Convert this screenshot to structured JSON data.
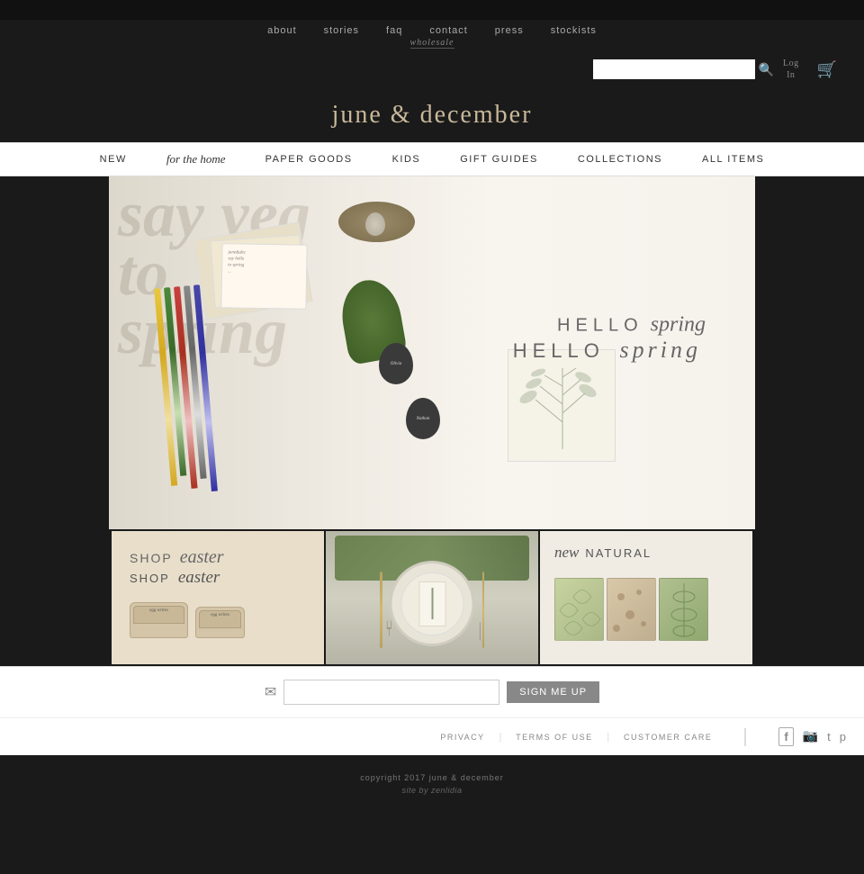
{
  "topbar": {
    "text": ""
  },
  "nav": {
    "items": [
      {
        "label": "about",
        "href": "#"
      },
      {
        "label": "stories",
        "href": "#"
      },
      {
        "label": "FAQ",
        "href": "#"
      },
      {
        "label": "contact",
        "href": "#"
      },
      {
        "label": "press",
        "href": "#"
      },
      {
        "label": "stockists",
        "href": "#"
      }
    ],
    "wholesale": "wholesale"
  },
  "header": {
    "search_placeholder": "",
    "search_icon": "🔍",
    "cart_icon": "🛒",
    "login_line1": "Log",
    "login_line2": "In",
    "logo": "june & december"
  },
  "main_nav": {
    "items": [
      {
        "label": "NEW",
        "style": "caps"
      },
      {
        "label": "for the HOME",
        "style": "script"
      },
      {
        "label": "PAPER GOODS",
        "style": "caps"
      },
      {
        "label": "KIDS",
        "style": "caps"
      },
      {
        "label": "GIFT GUIDES",
        "style": "caps"
      },
      {
        "label": "COLLECTIONS",
        "style": "caps"
      },
      {
        "label": "ALL ITEMS",
        "style": "caps"
      }
    ]
  },
  "hero": {
    "hello_text": "HELLO",
    "spring_text": "spring",
    "calligraphy_text": "say yeg to spring"
  },
  "panels": [
    {
      "id": "easter",
      "shop_label": "SHOP",
      "easter_label": "easter",
      "egg_label1": "egg writes",
      "egg_label2": "egg writes"
    },
    {
      "id": "natural-setting",
      "alt": "natural place setting with herbs and plates"
    },
    {
      "id": "new-natural",
      "new_label": "new",
      "natural_label": "NATURAL",
      "swatches": [
        {
          "color": "#c8d4a0",
          "pattern": "botanical"
        },
        {
          "color": "#d4e0a8",
          "pattern": "floral"
        },
        {
          "color": "#b8c890",
          "pattern": "leaf"
        },
        {
          "color": "#e0d4b0",
          "pattern": "neutral"
        }
      ]
    }
  ],
  "footer": {
    "email_placeholder": "",
    "sign_up_btn": "SIGN ME UP",
    "links": [
      {
        "label": "PRIVACY"
      },
      {
        "label": "TERMS OF USE"
      },
      {
        "label": "CUSTOMER CARE"
      }
    ],
    "social": [
      {
        "icon": "f",
        "name": "facebook"
      },
      {
        "icon": "📷",
        "name": "instagram"
      },
      {
        "icon": "t",
        "name": "twitter"
      },
      {
        "icon": "p",
        "name": "pinterest"
      }
    ],
    "copyright": "copyright 2017 june & december",
    "site_credit": "site by zenlidia"
  }
}
